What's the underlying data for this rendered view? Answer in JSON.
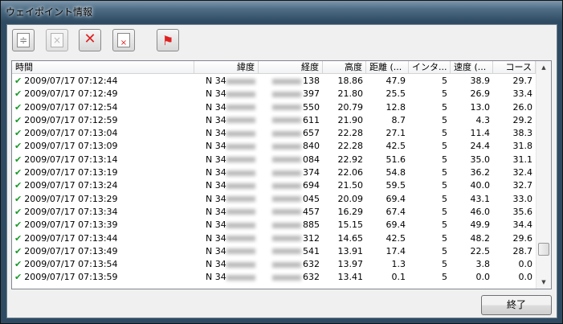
{
  "window": {
    "title": "ウェイポイント情報"
  },
  "toolbar": [
    {
      "name": "insert-button",
      "icon": "insert-icon"
    },
    {
      "name": "delete-disabled-button",
      "icon": "delete-gray-icon"
    },
    {
      "name": "delete-button",
      "icon": "red-x-icon"
    },
    {
      "name": "delete-below-button",
      "icon": "delete-below-icon"
    },
    {
      "name": "flag-button",
      "icon": "flag-icon"
    }
  ],
  "columns": [
    "時間",
    "緯度",
    "経度",
    "高度",
    "距離 (...",
    "インタ...",
    "速度 (...",
    "コース"
  ],
  "rows": [
    {
      "time": "2009/07/17 07:12:44",
      "lat": "N 34",
      "lon": "138",
      "alt": "18.86",
      "dist": "47.9",
      "int": "5",
      "speed": "38.9",
      "course": "29.7"
    },
    {
      "time": "2009/07/17 07:12:49",
      "lat": "N 34",
      "lon": "397",
      "alt": "21.80",
      "dist": "25.5",
      "int": "5",
      "speed": "26.9",
      "course": "33.4"
    },
    {
      "time": "2009/07/17 07:12:54",
      "lat": "N 34",
      "lon": "550",
      "alt": "20.79",
      "dist": "12.8",
      "int": "5",
      "speed": "13.0",
      "course": "26.0"
    },
    {
      "time": "2009/07/17 07:12:59",
      "lat": "N 34",
      "lon": "611",
      "alt": "21.90",
      "dist": "8.7",
      "int": "5",
      "speed": "4.3",
      "course": "29.2"
    },
    {
      "time": "2009/07/17 07:13:04",
      "lat": "N 34",
      "lon": "657",
      "alt": "22.28",
      "dist": "27.1",
      "int": "5",
      "speed": "11.4",
      "course": "38.3"
    },
    {
      "time": "2009/07/17 07:13:09",
      "lat": "N 34",
      "lon": "840",
      "alt": "22.28",
      "dist": "42.5",
      "int": "5",
      "speed": "24.4",
      "course": "31.8"
    },
    {
      "time": "2009/07/17 07:13:14",
      "lat": "N 34",
      "lon": "084",
      "alt": "22.92",
      "dist": "51.6",
      "int": "5",
      "speed": "35.0",
      "course": "31.1"
    },
    {
      "time": "2009/07/17 07:13:19",
      "lat": "N 34",
      "lon": "374",
      "alt": "22.06",
      "dist": "54.8",
      "int": "5",
      "speed": "36.2",
      "course": "32.4"
    },
    {
      "time": "2009/07/17 07:13:24",
      "lat": "N 34",
      "lon": "694",
      "alt": "21.50",
      "dist": "59.5",
      "int": "5",
      "speed": "40.0",
      "course": "32.7"
    },
    {
      "time": "2009/07/17 07:13:29",
      "lat": "N 34",
      "lon": "045",
      "alt": "20.09",
      "dist": "69.4",
      "int": "5",
      "speed": "43.1",
      "course": "33.0"
    },
    {
      "time": "2009/07/17 07:13:34",
      "lat": "N 34",
      "lon": "457",
      "alt": "16.29",
      "dist": "67.4",
      "int": "5",
      "speed": "46.0",
      "course": "35.6"
    },
    {
      "time": "2009/07/17 07:13:39",
      "lat": "N 34",
      "lon": "885",
      "alt": "15.15",
      "dist": "69.4",
      "int": "5",
      "speed": "49.9",
      "course": "34.4"
    },
    {
      "time": "2009/07/17 07:13:44",
      "lat": "N 34",
      "lon": "312",
      "alt": "14.65",
      "dist": "42.5",
      "int": "5",
      "speed": "48.2",
      "course": "29.6"
    },
    {
      "time": "2009/07/17 07:13:49",
      "lat": "N 34",
      "lon": "541",
      "alt": "13.91",
      "dist": "17.4",
      "int": "5",
      "speed": "22.5",
      "course": "28.7"
    },
    {
      "time": "2009/07/17 07:13:54",
      "lat": "N 34",
      "lon": "632",
      "alt": "13.97",
      "dist": "1.3",
      "int": "5",
      "speed": "3.8",
      "course": "0.0"
    },
    {
      "time": "2009/07/17 07:13:59",
      "lat": "N 34",
      "lon": "632",
      "alt": "13.41",
      "dist": "0.1",
      "int": "5",
      "speed": "0.0",
      "course": "0.0"
    }
  ],
  "close_button": "終了"
}
